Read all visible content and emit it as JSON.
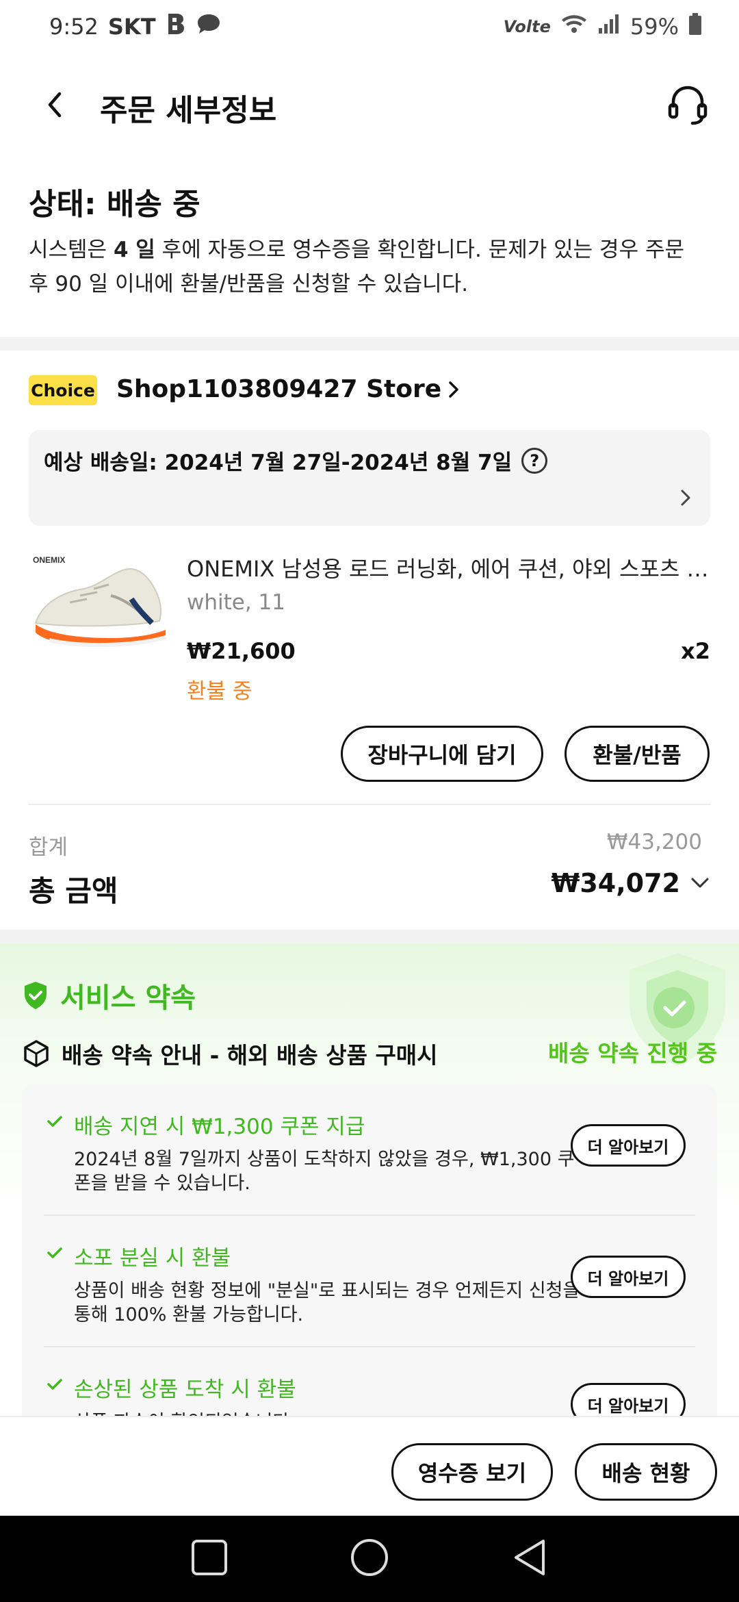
{
  "status_bar": {
    "time": "9:52",
    "carrier": "SKT",
    "volte": "Volte",
    "battery": "59%"
  },
  "header": {
    "title": "주문 세부정보"
  },
  "order_status": {
    "title": "상태: 배송 중",
    "desc_prefix": "시스템은 ",
    "desc_days": "4 일",
    "desc_suffix": " 후에 자동으로 영수증을 확인합니다. 문제가 있는 경우 주문 후 90 일 이내에 환불/반품을 신청할 수 있습니다."
  },
  "store": {
    "badge": "Choice",
    "name": "Shop1103809427 Store"
  },
  "delivery": {
    "estimate": "예상 배송일: 2024년 7월 27일-2024년 8월 7일"
  },
  "product": {
    "brand_logo": "ONEMIX",
    "name": "ONEMIX 남성용 로드 러닝화, 에어 쿠션, 야외 스포츠 신발, 조깅 운동화",
    "variant": "white, 11",
    "price": "₩21,600",
    "quantity": "x2",
    "status": "환불 중",
    "add_to_cart": "장바구니에 담기",
    "refund": "환불/반품"
  },
  "totals": {
    "subtotal_label": "합계",
    "subtotal_value": "₩43,200",
    "total_label": "총 금액",
    "total_value": "₩34,072"
  },
  "service_promise": {
    "title": "서비스 약속",
    "subtitle": "배송 약속 안내 - 해외 배송 상품 구매시",
    "progress": "배송 약속 진행 중",
    "items": [
      {
        "title": "배송 지연 시 ₩1,300 쿠폰 지급",
        "desc": "2024년 8월 7일까지 상품이 도착하지 않았을 경우, ₩1,300 쿠폰을 받을 수 있습니다.",
        "button": "더 알아보기"
      },
      {
        "title": "소포 분실 시 환불",
        "desc": "상품이 배송 현황 정보에 \"분실\"로 표시되는 경우 언제든지 신청을 통해 100% 환불 가능합니다.",
        "button": "더 알아보기"
      },
      {
        "title": "손상된 상품 도착 시 환불",
        "desc": "상품 파손이 확인되었습니다.",
        "button": "더 알아보기"
      }
    ]
  },
  "actions": {
    "receipt": "영수증 보기",
    "tracking": "배송 현황"
  },
  "colors": {
    "accent_green": "#40b81f",
    "refund_orange": "#f5821f",
    "choice_yellow": "#fde047"
  }
}
